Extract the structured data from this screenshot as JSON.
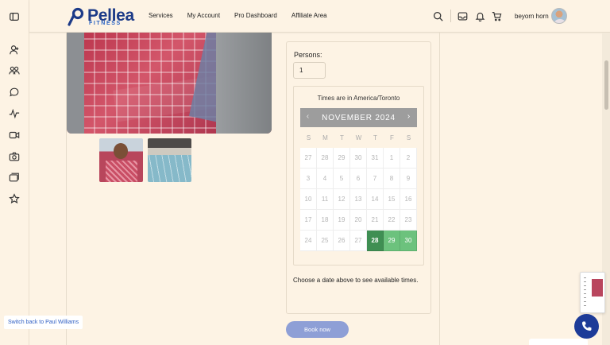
{
  "brand": {
    "name": "Pellea",
    "sub": "FITNESS",
    "color": "#1d3b88"
  },
  "nav": {
    "items": [
      "Services",
      "My Account",
      "Pro Dashboard",
      "Affiliate Area"
    ]
  },
  "header_icons": [
    "search-icon",
    "inbox-icon",
    "bell-icon",
    "cart-icon"
  ],
  "user": {
    "name": "beyorn horn"
  },
  "rail_icons": [
    "sidebar-toggle-icon",
    "user-icon",
    "group-icon",
    "chat-icon",
    "activity-icon",
    "video-icon",
    "camera-icon",
    "gallery-icon",
    "star-icon"
  ],
  "booking": {
    "persons_label": "Persons:",
    "persons_value": "1",
    "timezone_text": "Times are in America/Toronto",
    "calendar": {
      "month_label": "NOVEMBER 2024",
      "prev_label": "‹",
      "next_label": "›",
      "weekdays": [
        "S",
        "M",
        "T",
        "W",
        "T",
        "F",
        "S"
      ],
      "weeks": [
        [
          {
            "d": "27",
            "s": "off"
          },
          {
            "d": "28",
            "s": "off"
          },
          {
            "d": "29",
            "s": "off"
          },
          {
            "d": "30",
            "s": "off"
          },
          {
            "d": "31",
            "s": "off"
          },
          {
            "d": "1",
            "s": "off"
          },
          {
            "d": "2",
            "s": "off"
          }
        ],
        [
          {
            "d": "3",
            "s": "off"
          },
          {
            "d": "4",
            "s": "off"
          },
          {
            "d": "5",
            "s": "off"
          },
          {
            "d": "6",
            "s": "off"
          },
          {
            "d": "7",
            "s": "off"
          },
          {
            "d": "8",
            "s": "off"
          },
          {
            "d": "9",
            "s": "off"
          }
        ],
        [
          {
            "d": "10",
            "s": "off"
          },
          {
            "d": "11",
            "s": "off"
          },
          {
            "d": "12",
            "s": "off"
          },
          {
            "d": "13",
            "s": "off"
          },
          {
            "d": "14",
            "s": "off"
          },
          {
            "d": "15",
            "s": "off"
          },
          {
            "d": "16",
            "s": "off"
          }
        ],
        [
          {
            "d": "17",
            "s": "off"
          },
          {
            "d": "18",
            "s": "off"
          },
          {
            "d": "19",
            "s": "off"
          },
          {
            "d": "20",
            "s": "off"
          },
          {
            "d": "21",
            "s": "off"
          },
          {
            "d": "22",
            "s": "off"
          },
          {
            "d": "23",
            "s": "off"
          }
        ],
        [
          {
            "d": "24",
            "s": "off"
          },
          {
            "d": "25",
            "s": "off"
          },
          {
            "d": "26",
            "s": "off"
          },
          {
            "d": "27",
            "s": "off"
          },
          {
            "d": "28",
            "s": "selected"
          },
          {
            "d": "29",
            "s": "avail"
          },
          {
            "d": "30",
            "s": "avail"
          }
        ]
      ],
      "colors": {
        "available": "#6cc27d",
        "selected": "#3f8f53",
        "header": "#9d9d9d"
      }
    },
    "choose_text": "Choose a date above to see available times.",
    "book_label": "Book now",
    "book_color": "#8e9fd6"
  },
  "switch_back_label": "Switch back to Paul Williams",
  "phone_color": "#1d3b98"
}
